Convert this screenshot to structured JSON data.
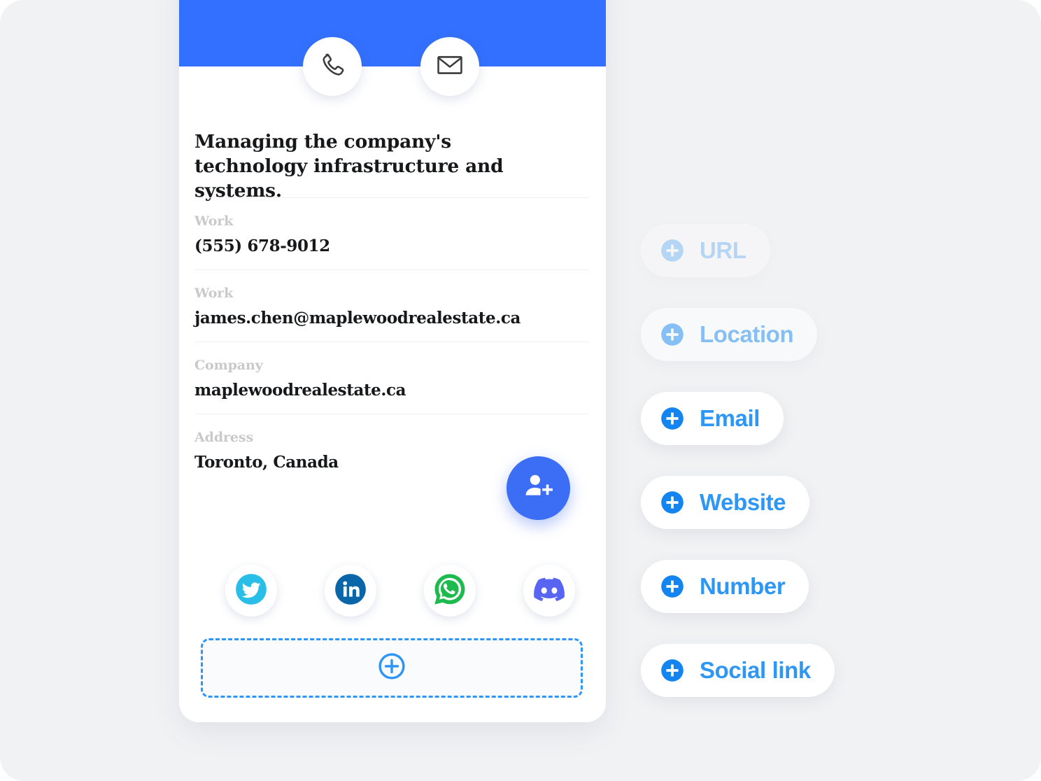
{
  "theme": {
    "page_background": "#F1F2F4",
    "header_blue": "#3370FF",
    "accent_blue": "#2E96F5",
    "fab_blue": "#3B6EF5",
    "text_dark": "#17181A",
    "label_gray": "#C9C9CB"
  },
  "card": {
    "header_actions": [
      {
        "name": "call-action",
        "icon": "phone-icon"
      },
      {
        "name": "email-action",
        "icon": "envelope-icon"
      }
    ],
    "description": "Managing the company's technology infrastructure and systems.",
    "fields": [
      {
        "label": "Work",
        "value": "(555) 678-9012",
        "icon": "phone-field"
      },
      {
        "label": "Work",
        "value": "james.chen@maplewoodrealestate.ca",
        "icon": "email-field"
      },
      {
        "label": "Company",
        "value": "maplewoodrealestate.ca",
        "icon": "company-field"
      },
      {
        "label": "Address",
        "value": "Toronto, Canada",
        "icon": "address-field"
      }
    ],
    "fab": {
      "icon": "person-add-icon",
      "label": "Add contact"
    },
    "social_links": [
      {
        "name": "twitter",
        "icon": "twitter-icon",
        "color": "#29BEE8"
      },
      {
        "name": "linkedin",
        "icon": "linkedin-icon",
        "color": "#0A66A8"
      },
      {
        "name": "whatsapp",
        "icon": "whatsapp-icon",
        "color": "#1FBA4D"
      },
      {
        "name": "discord",
        "icon": "discord-icon",
        "color": "#5865F2"
      }
    ],
    "add_placeholder": {
      "icon": "plus-circle-icon",
      "label": ""
    }
  },
  "pill_menu": {
    "items": [
      {
        "label": "URL",
        "icon": "plus-circle-icon",
        "opacity": 0.3
      },
      {
        "label": "Location",
        "icon": "plus-circle-icon",
        "opacity": 0.55
      },
      {
        "label": "Email",
        "icon": "plus-circle-icon",
        "opacity": 1.0
      },
      {
        "label": "Website",
        "icon": "plus-circle-icon",
        "opacity": 1.0
      },
      {
        "label": "Number",
        "icon": "plus-circle-icon",
        "opacity": 1.0
      },
      {
        "label": "Social link",
        "icon": "plus-circle-icon",
        "opacity": 1.0
      }
    ]
  }
}
